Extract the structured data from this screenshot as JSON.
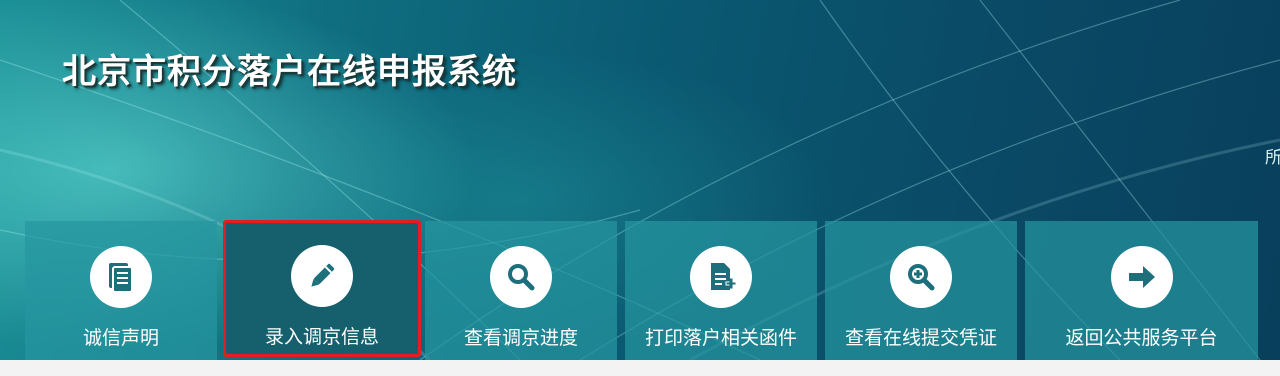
{
  "header": {
    "title": "北京市积分落户在线申报系统",
    "side_fragment": "所"
  },
  "nav": {
    "items": [
      {
        "label": "诚信声明",
        "icon": "document-list-icon"
      },
      {
        "label": "录入调京信息",
        "icon": "pencil-icon",
        "active": true
      },
      {
        "label": "查看调京进度",
        "icon": "search-icon"
      },
      {
        "label": "打印落户相关函件",
        "icon": "document-add-icon"
      },
      {
        "label": "查看在线提交凭证",
        "icon": "zoom-in-icon"
      },
      {
        "label": "返回公共服务平台",
        "icon": "arrow-right-icon"
      }
    ]
  },
  "colors": {
    "banner": "#0a5972",
    "tile": "#2696a0",
    "tile_active": "#16606e",
    "active_border": "#e02020",
    "icon_fg": "#1c6f7b"
  }
}
